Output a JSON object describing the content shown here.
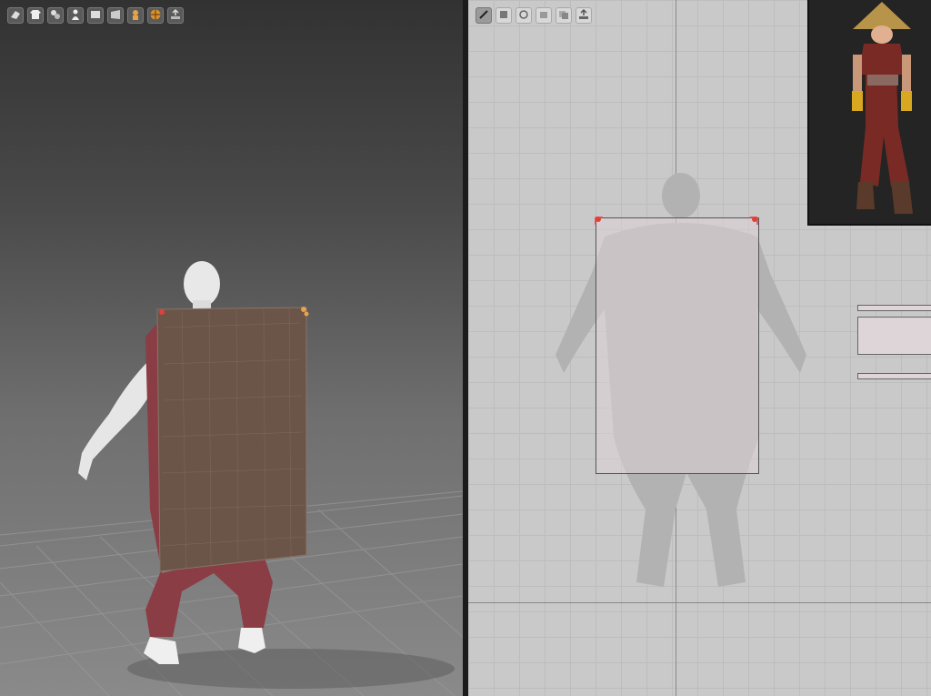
{
  "toolbar_3d": {
    "buttons": [
      {
        "icon": "simulate-icon"
      },
      {
        "icon": "garment-icon"
      },
      {
        "icon": "sewing-icon"
      },
      {
        "icon": "avatar-icon"
      },
      {
        "icon": "fabric-icon"
      },
      {
        "icon": "texture-icon"
      },
      {
        "icon": "skin-icon"
      },
      {
        "icon": "mesh-icon"
      },
      {
        "icon": "export-icon"
      }
    ]
  },
  "toolbar_2d": {
    "buttons": [
      {
        "icon": "edit-pattern-icon",
        "active": true
      },
      {
        "icon": "transform-icon",
        "active": false
      },
      {
        "icon": "seam-icon",
        "active": false
      },
      {
        "icon": "segment-icon",
        "active": false
      },
      {
        "icon": "layer-icon",
        "active": false
      },
      {
        "icon": "save-icon",
        "active": false
      }
    ]
  },
  "colors": {
    "fabric": "#6b5448",
    "trousers": "#8a3d44",
    "point": "#e0403a",
    "pin": "#e8a24a"
  }
}
